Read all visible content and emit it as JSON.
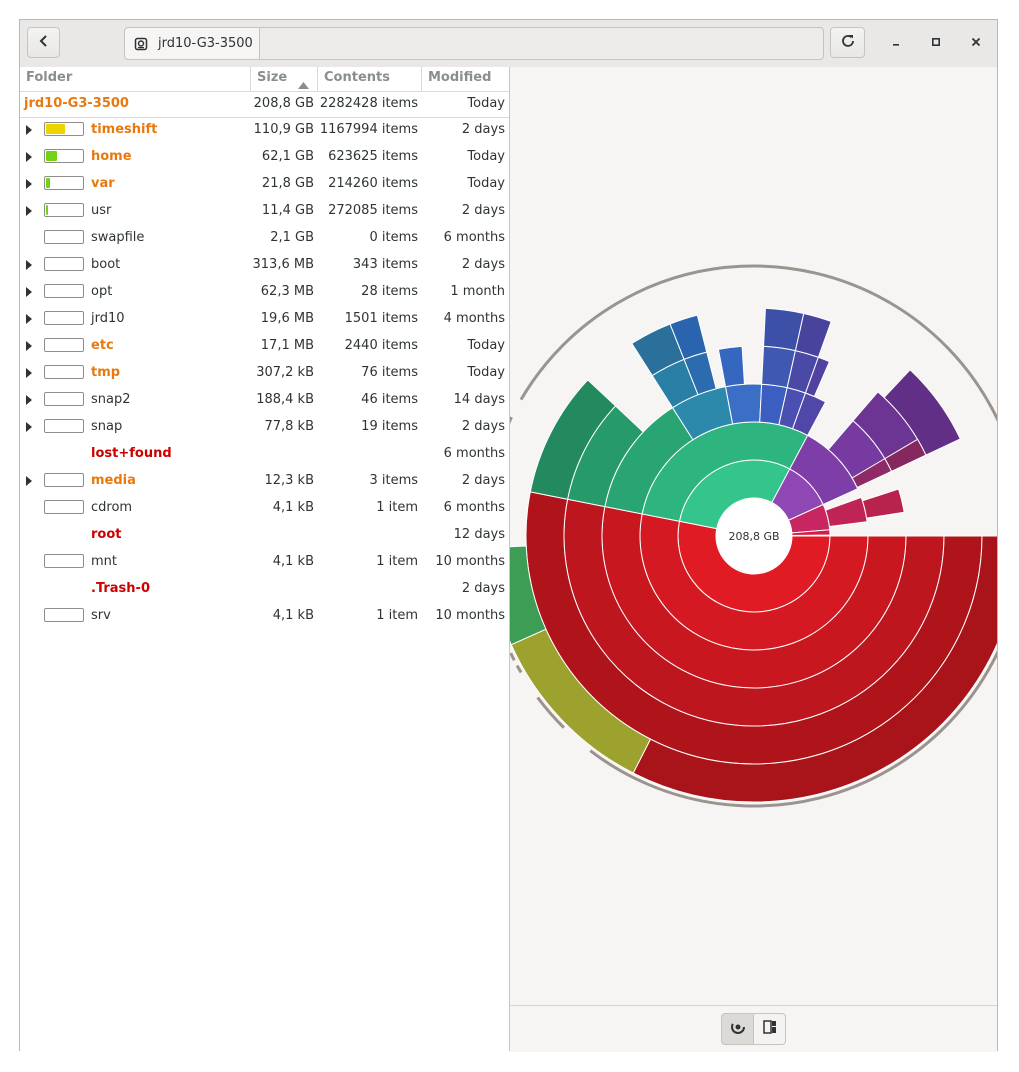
{
  "header": {
    "back_icon": "go-previous-icon",
    "location": "jrd10-G3-3500",
    "reload_icon": "view-refresh-icon",
    "minimize_icon": "window-minimize-icon",
    "maximize_icon": "window-maximize-icon",
    "close_icon": "window-close-icon"
  },
  "columns": {
    "folder": "Folder",
    "size": "Size",
    "contents": "Contents",
    "modified": "Modified"
  },
  "root_row": {
    "name": "jrd10-G3-3500",
    "size": "208,8 GB",
    "contents": "2282428 items",
    "modified": "Today"
  },
  "rows": [
    {
      "name": "timeshift",
      "size": "110,9 GB",
      "contents": "1167994 items",
      "modified": "2 days",
      "style": "orange",
      "expander": true,
      "bar": true,
      "fill": 0.531,
      "fill_color": "#edd400"
    },
    {
      "name": "home",
      "size": "62,1 GB",
      "contents": "623625 items",
      "modified": "Today",
      "style": "orange",
      "expander": true,
      "bar": true,
      "fill": 0.297,
      "fill_color": "#73d216"
    },
    {
      "name": "var",
      "size": "21,8 GB",
      "contents": "214260 items",
      "modified": "Today",
      "style": "orange",
      "expander": true,
      "bar": true,
      "fill": 0.104,
      "fill_color": "#73d216"
    },
    {
      "name": "usr",
      "size": "11,4 GB",
      "contents": "272085 items",
      "modified": "2 days",
      "style": "normal",
      "expander": true,
      "bar": true,
      "fill": 0.055,
      "fill_color": "#73d216"
    },
    {
      "name": "swapfile",
      "size": "2,1 GB",
      "contents": "0 items",
      "modified": "6 months",
      "style": "normal",
      "expander": false,
      "bar": true,
      "fill": 0,
      "fill_color": "#73d216"
    },
    {
      "name": "boot",
      "size": "313,6 MB",
      "contents": "343 items",
      "modified": "2 days",
      "style": "normal",
      "expander": true,
      "bar": true,
      "fill": 0,
      "fill_color": "#73d216"
    },
    {
      "name": "opt",
      "size": "62,3 MB",
      "contents": "28 items",
      "modified": "1 month",
      "style": "normal",
      "expander": true,
      "bar": true,
      "fill": 0,
      "fill_color": "#73d216"
    },
    {
      "name": "jrd10",
      "size": "19,6 MB",
      "contents": "1501 items",
      "modified": "4 months",
      "style": "normal",
      "expander": true,
      "bar": true,
      "fill": 0,
      "fill_color": "#73d216"
    },
    {
      "name": "etc",
      "size": "17,1 MB",
      "contents": "2440 items",
      "modified": "Today",
      "style": "orange",
      "expander": true,
      "bar": true,
      "fill": 0,
      "fill_color": "#73d216"
    },
    {
      "name": "tmp",
      "size": "307,2 kB",
      "contents": "76 items",
      "modified": "Today",
      "style": "orange",
      "expander": true,
      "bar": true,
      "fill": 0,
      "fill_color": "#73d216"
    },
    {
      "name": "snap2",
      "size": "188,4 kB",
      "contents": "46 items",
      "modified": "14 days",
      "style": "normal",
      "expander": true,
      "bar": true,
      "fill": 0,
      "fill_color": "#73d216"
    },
    {
      "name": "snap",
      "size": "77,8 kB",
      "contents": "19 items",
      "modified": "2 days",
      "style": "normal",
      "expander": true,
      "bar": true,
      "fill": 0,
      "fill_color": "#73d216"
    },
    {
      "name": "lost+found",
      "size": "",
      "contents": "",
      "modified": "6 months",
      "style": "red",
      "expander": false,
      "bar": false,
      "fill": 0,
      "fill_color": "#73d216"
    },
    {
      "name": "media",
      "size": "12,3 kB",
      "contents": "3 items",
      "modified": "2 days",
      "style": "orange",
      "expander": true,
      "bar": true,
      "fill": 0,
      "fill_color": "#73d216"
    },
    {
      "name": "cdrom",
      "size": "4,1 kB",
      "contents": "1 item",
      "modified": "6 months",
      "style": "normal",
      "expander": false,
      "bar": true,
      "fill": 0,
      "fill_color": "#73d216"
    },
    {
      "name": "root",
      "size": "",
      "contents": "",
      "modified": "12 days",
      "style": "red",
      "expander": false,
      "bar": false,
      "fill": 0,
      "fill_color": "#73d216"
    },
    {
      "name": "mnt",
      "size": "4,1 kB",
      "contents": "1 item",
      "modified": "10 months",
      "style": "normal",
      "expander": false,
      "bar": true,
      "fill": 0,
      "fill_color": "#73d216"
    },
    {
      "name": ".Trash-0",
      "size": "",
      "contents": "",
      "modified": "2 days",
      "style": "red",
      "expander": false,
      "bar": false,
      "fill": 0,
      "fill_color": "#73d216"
    },
    {
      "name": "srv",
      "size": "4,1 kB",
      "contents": "1 item",
      "modified": "10 months",
      "style": "normal",
      "expander": false,
      "bar": true,
      "fill": 0,
      "fill_color": "#73d216"
    }
  ],
  "ring_chart": {
    "center_label": "208,8 GB",
    "segments": [
      {
        "depth": 1,
        "start": 0,
        "end": 0.531,
        "color": "#e01b24"
      },
      {
        "depth": 2,
        "start": 0,
        "end": 0.531,
        "color": "#d41922"
      },
      {
        "depth": 3,
        "start": 0,
        "end": 0.531,
        "color": "#c8171f"
      },
      {
        "depth": 4,
        "start": 0,
        "end": 0.531,
        "color": "#bd161e"
      },
      {
        "depth": 5,
        "start": 0,
        "end": 0.531,
        "color": "#b0141b"
      },
      {
        "depth": 6,
        "start": 0,
        "end": 0.325,
        "color": "#a8141a"
      },
      {
        "depth": 6,
        "start": 0.325,
        "end": 0.433,
        "color": "#9da12e"
      },
      {
        "depth": 6,
        "start": 0.433,
        "end": 0.493,
        "color": "#3e9d55"
      },
      {
        "depth": 1,
        "start": 0.531,
        "end": 0.828,
        "color": "#33c58c"
      },
      {
        "depth": 2,
        "start": 0.531,
        "end": 0.828,
        "color": "#2eb57f"
      },
      {
        "depth": 3,
        "start": 0.531,
        "end": 0.66,
        "color": "#29a574"
      },
      {
        "depth": 4,
        "start": 0.531,
        "end": 0.62,
        "color": "#279a6c"
      },
      {
        "depth": 5,
        "start": 0.531,
        "end": 0.62,
        "color": "#228a5e"
      },
      {
        "depth": 3,
        "start": 0.66,
        "end": 0.72,
        "color": "#2d89ab"
      },
      {
        "depth": 4,
        "start": 0.66,
        "end": 0.69,
        "color": "#2a7fa6"
      },
      {
        "depth": 5,
        "start": 0.66,
        "end": 0.69,
        "color": "#2a709a"
      },
      {
        "depth": 4,
        "start": 0.69,
        "end": 0.71,
        "color": "#2a6cae"
      },
      {
        "depth": 5,
        "start": 0.69,
        "end": 0.71,
        "color": "#2a64ae"
      },
      {
        "depth": 3,
        "start": 0.72,
        "end": 0.758,
        "color": "#3b6fc6"
      },
      {
        "depth": 4,
        "start": 0.72,
        "end": 0.74,
        "color": "#3567c0"
      },
      {
        "depth": 3,
        "start": 0.758,
        "end": 0.785,
        "color": "#3a5fc0"
      },
      {
        "depth": 4,
        "start": 0.758,
        "end": 0.785,
        "color": "#3f58b2"
      },
      {
        "depth": 5,
        "start": 0.758,
        "end": 0.785,
        "color": "#3d50a8"
      },
      {
        "depth": 3,
        "start": 0.785,
        "end": 0.805,
        "color": "#4a4fb0"
      },
      {
        "depth": 4,
        "start": 0.785,
        "end": 0.805,
        "color": "#4a4aa6"
      },
      {
        "depth": 5,
        "start": 0.785,
        "end": 0.805,
        "color": "#48449e"
      },
      {
        "depth": 3,
        "start": 0.805,
        "end": 0.828,
        "color": "#5147a8"
      },
      {
        "depth": 4,
        "start": 0.805,
        "end": 0.815,
        "color": "#5242a0"
      },
      {
        "depth": 1,
        "start": 0.828,
        "end": 0.932,
        "color": "#8e47b3"
      },
      {
        "depth": 2,
        "start": 0.828,
        "end": 0.932,
        "color": "#7e3ea8"
      },
      {
        "depth": 3,
        "start": 0.863,
        "end": 0.93,
        "color": "#763aa0"
      },
      {
        "depth": 4,
        "start": 0.863,
        "end": 0.93,
        "color": "#6c3594"
      },
      {
        "depth": 5,
        "start": 0.87,
        "end": 0.93,
        "color": "#622f87"
      },
      {
        "depth": 3,
        "start": 0.915,
        "end": 0.93,
        "color": "#8e2a66"
      },
      {
        "depth": 4,
        "start": 0.915,
        "end": 0.93,
        "color": "#84285e"
      },
      {
        "depth": 1,
        "start": 0.932,
        "end": 0.987,
        "color": "#c72660"
      },
      {
        "depth": 2,
        "start": 0.945,
        "end": 0.98,
        "color": "#c02355"
      },
      {
        "depth": 3,
        "start": 0.95,
        "end": 0.975,
        "color": "#b8234e"
      },
      {
        "depth": 1,
        "start": 0.987,
        "end": 0.998,
        "color": "#d11f44"
      }
    ]
  },
  "footer": {
    "ring_icon": "ring-chart-icon",
    "treemap_icon": "treemap-icon"
  }
}
